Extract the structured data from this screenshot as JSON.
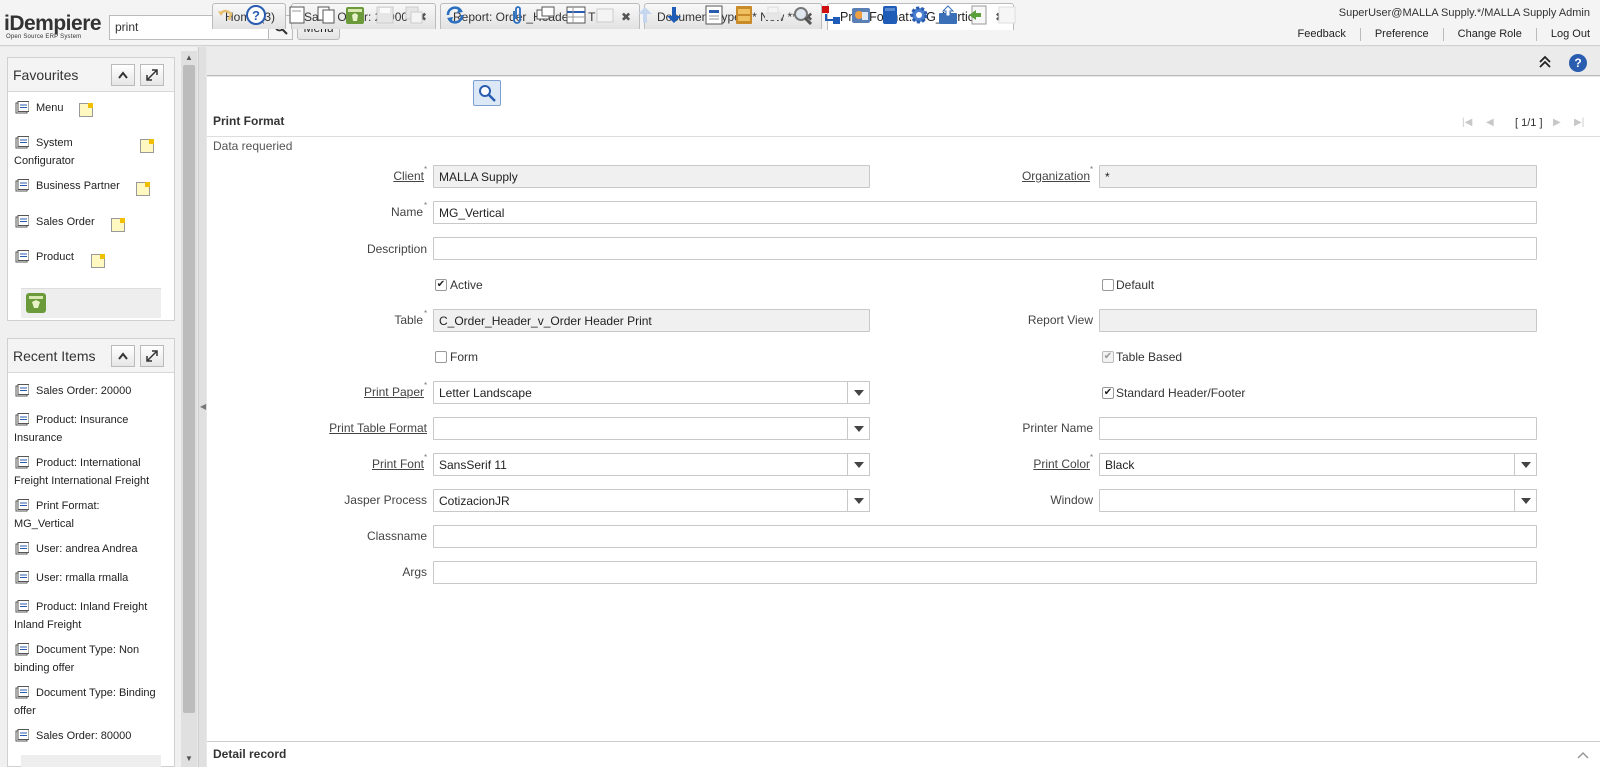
{
  "header": {
    "logo_big": "iDempiere",
    "logo_small": "Open Source ERP System",
    "search_value": "print",
    "menu_label": "Menu",
    "user_info": "SuperUser@MALLA Supply.*/MALLA Supply Admin",
    "links": [
      "Feedback",
      "Preference",
      "Change Role",
      "Log Out"
    ]
  },
  "favourites": {
    "title": "Favourites",
    "items": [
      "Menu",
      "System Configurator",
      "Business Partner",
      "Sales Order",
      "Product"
    ]
  },
  "recent": {
    "title": "Recent Items",
    "items": [
      "Sales Order: 20000",
      "Product: Insurance Insurance",
      "Product: International Freight International Freight",
      "Print Format: MG_Vertical",
      "User: andrea Andrea",
      "User: rmalla rmalla",
      "Product: Inland Freight Inland Freight",
      "Document Type: Non binding offer",
      "Document Type: Binding offer",
      "Sales Order: 80000"
    ]
  },
  "tabs": [
    "Home (3)",
    "Sales Order: 20000",
    "Report: Order_Header ** TE...",
    "Document Type: ** New **",
    "Print Format: MG_Vertical"
  ],
  "form": {
    "title": "Print Format",
    "record_nav": "[ 1/1 ]",
    "status": "Data requeried",
    "labels": {
      "client": "Client",
      "organization": "Organization",
      "name": "Name",
      "description": "Description",
      "active": "Active",
      "default": "Default",
      "table": "Table",
      "report_view": "Report View",
      "form": "Form",
      "table_based": "Table Based",
      "print_paper": "Print Paper",
      "standard_header_footer": "Standard Header/Footer",
      "print_table_format": "Print Table Format",
      "printer_name": "Printer Name",
      "print_font": "Print Font",
      "print_color": "Print Color",
      "jasper_process": "Jasper Process",
      "window": "Window",
      "classname": "Classname",
      "args": "Args"
    },
    "values": {
      "client": "MALLA Supply",
      "organization": "*",
      "name": "MG_Vertical",
      "description": "",
      "table": "C_Order_Header_v_Order Header Print",
      "report_view": "",
      "print_paper": "Letter Landscape",
      "print_table_format": "",
      "printer_name": "",
      "print_font": "SansSerif 11",
      "print_color": "Black",
      "jasper_process": "CotizacionJR",
      "window": "",
      "classname": "",
      "args": ""
    },
    "mandatory_mark": "*",
    "check_mark": "✔"
  },
  "detail": {
    "title": "Detail record"
  },
  "colors": {
    "accent": "#2a5db0",
    "mandatory": "#777777"
  }
}
